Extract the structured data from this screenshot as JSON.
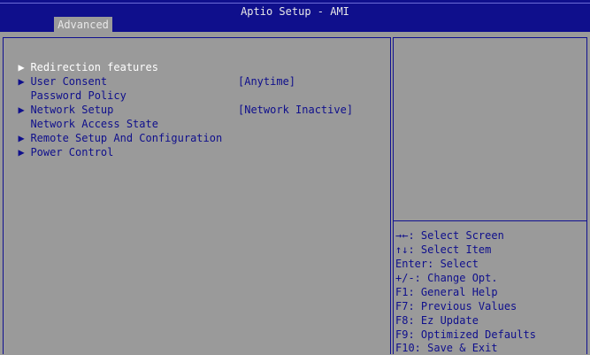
{
  "app_title": "Aptio Setup - AMI",
  "tabs": [
    {
      "label": "Advanced"
    }
  ],
  "menu": {
    "items": [
      {
        "label": "Redirection features",
        "submenu": true,
        "value": ""
      },
      {
        "label": "User Consent",
        "submenu": true,
        "value": ""
      },
      {
        "label": "Password Policy",
        "submenu": false,
        "value": "[Anytime]"
      },
      {
        "label": "Network Setup",
        "submenu": true,
        "value": ""
      },
      {
        "label": "Network Access State",
        "submenu": false,
        "value": "[Network Inactive]"
      },
      {
        "label": "Remote Setup And Configuration",
        "submenu": true,
        "value": ""
      },
      {
        "label": "Power Control",
        "submenu": true,
        "value": ""
      }
    ],
    "submenu_arrow": "▶"
  },
  "help": {
    "keys": [
      "→←: Select Screen",
      "↑↓: Select Item",
      "Enter: Select",
      "+/-: Change Opt.",
      "F1: General Help",
      "F7: Previous Values",
      "F8: Ez Update",
      "F9: Optimized Defaults",
      "F10: Save & Exit"
    ]
  },
  "colors": {
    "header_bg": "#0f0f8c",
    "body_bg": "#9a9a9a",
    "text": "#0f0f8c",
    "selected_text": "#ffffff"
  }
}
